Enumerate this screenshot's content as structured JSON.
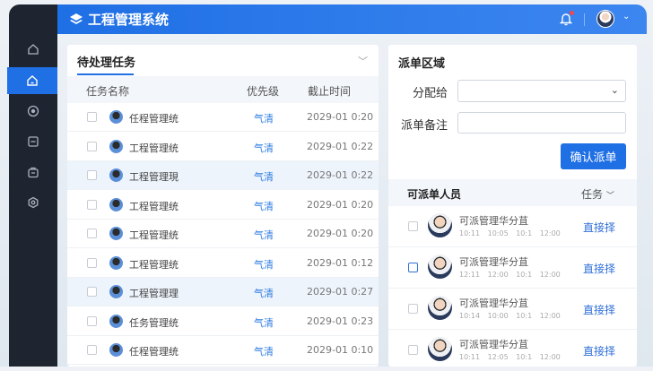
{
  "app": {
    "title": "工程管理系统"
  },
  "sidebar": {
    "items": [
      {
        "icon": "home-icon"
      },
      {
        "icon": "home-icon",
        "active": true
      },
      {
        "icon": "compass-icon"
      },
      {
        "icon": "document-icon"
      },
      {
        "icon": "bag-icon"
      },
      {
        "icon": "gear-icon"
      }
    ]
  },
  "tasks": {
    "title": "待处理任务",
    "columns": [
      "任务名称",
      "优先级",
      "截止时间"
    ],
    "rows": [
      {
        "name": "任程管理统",
        "priority": "气清",
        "due": "2029-01 0:20"
      },
      {
        "name": "工程管理统",
        "priority": "气清",
        "due": "2029-01 0:22"
      },
      {
        "name": "工程管理現",
        "priority": "气清",
        "due": "2029-01 0:22",
        "highlight": true
      },
      {
        "name": "工程管理统",
        "priority": "气清",
        "due": "2029-01 0:20"
      },
      {
        "name": "工程管理统",
        "priority": "气清",
        "due": "2029-01 0:20"
      },
      {
        "name": "工程管理统",
        "priority": "气清",
        "due": "2029-01 0:12"
      },
      {
        "name": "工程管理理",
        "priority": "气清",
        "due": "2029-01 0:27",
        "highlight": true
      },
      {
        "name": "任务管理统",
        "priority": "气清",
        "due": "2029-01 0:23"
      },
      {
        "name": "任程管理统",
        "priority": "气清",
        "due": "2029-01 0:10"
      }
    ]
  },
  "dispatch": {
    "title": "派单区域",
    "assign_label": "分配给",
    "assign_value": "",
    "note_label": "派单备注",
    "note_value": "",
    "confirm": "确认派单"
  },
  "people": {
    "title": "可派单人员",
    "filter": "任务",
    "rows": [
      {
        "name": "可派管理华分苴",
        "times": "10:11 10:05 10:1 12:00",
        "action": "直接择",
        "checked": false
      },
      {
        "name": "可派管理华分苴",
        "times": "12:11 12:00 10:1 12:00",
        "action": "直接择",
        "checked": true
      },
      {
        "name": "可派管理华分苴",
        "times": "10:14 10:00 10:1 12:00",
        "action": "直接择",
        "checked": false
      },
      {
        "name": "可派管理华分苴",
        "times": "10:11 12:05 10:1 12:00",
        "action": "直接择",
        "checked": false
      }
    ]
  }
}
